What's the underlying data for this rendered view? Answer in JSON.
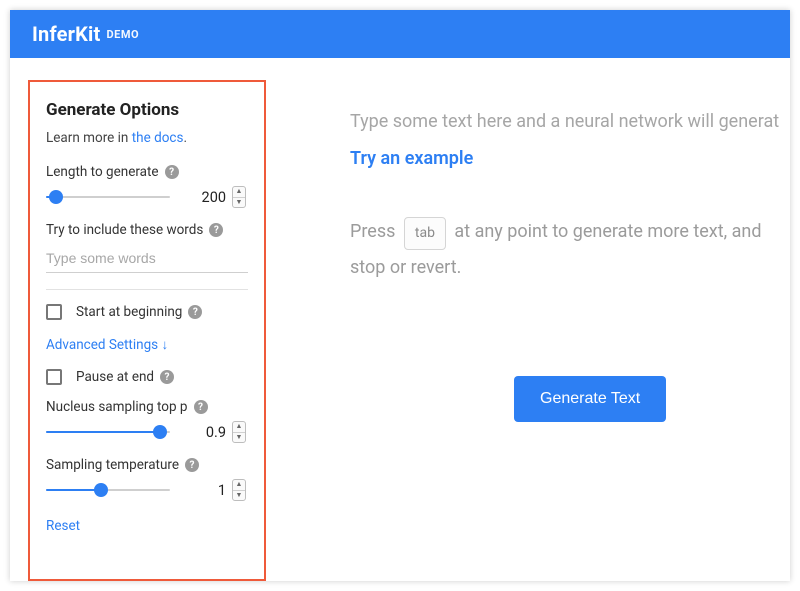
{
  "header": {
    "brand": "InferKit",
    "brand_sub": "DEMO"
  },
  "sidebar": {
    "title": "Generate Options",
    "learn_prefix": "Learn more in ",
    "learn_link": "the docs",
    "learn_suffix": ".",
    "length_label": "Length to generate",
    "length_value": "200",
    "length_pct": 8,
    "include_label": "Try to include these words",
    "include_placeholder": "Type some words",
    "start_label": "Start at beginning",
    "advanced_label": "Advanced Settings ↓",
    "pause_label": "Pause at end",
    "nucleus_label": "Nucleus sampling top p",
    "nucleus_value": "0.9",
    "nucleus_pct": 92,
    "temp_label": "Sampling temperature",
    "temp_value": "1",
    "temp_pct": 44,
    "reset_label": "Reset"
  },
  "main": {
    "placeholder": "Type some text here and a neural network will generat",
    "try_link": "Try an example",
    "hint_1": "Press ",
    "kbd": "tab",
    "hint_2": " at any point to generate more text, and ",
    "hint_3": "stop or revert.",
    "generate_button": "Generate Text"
  }
}
